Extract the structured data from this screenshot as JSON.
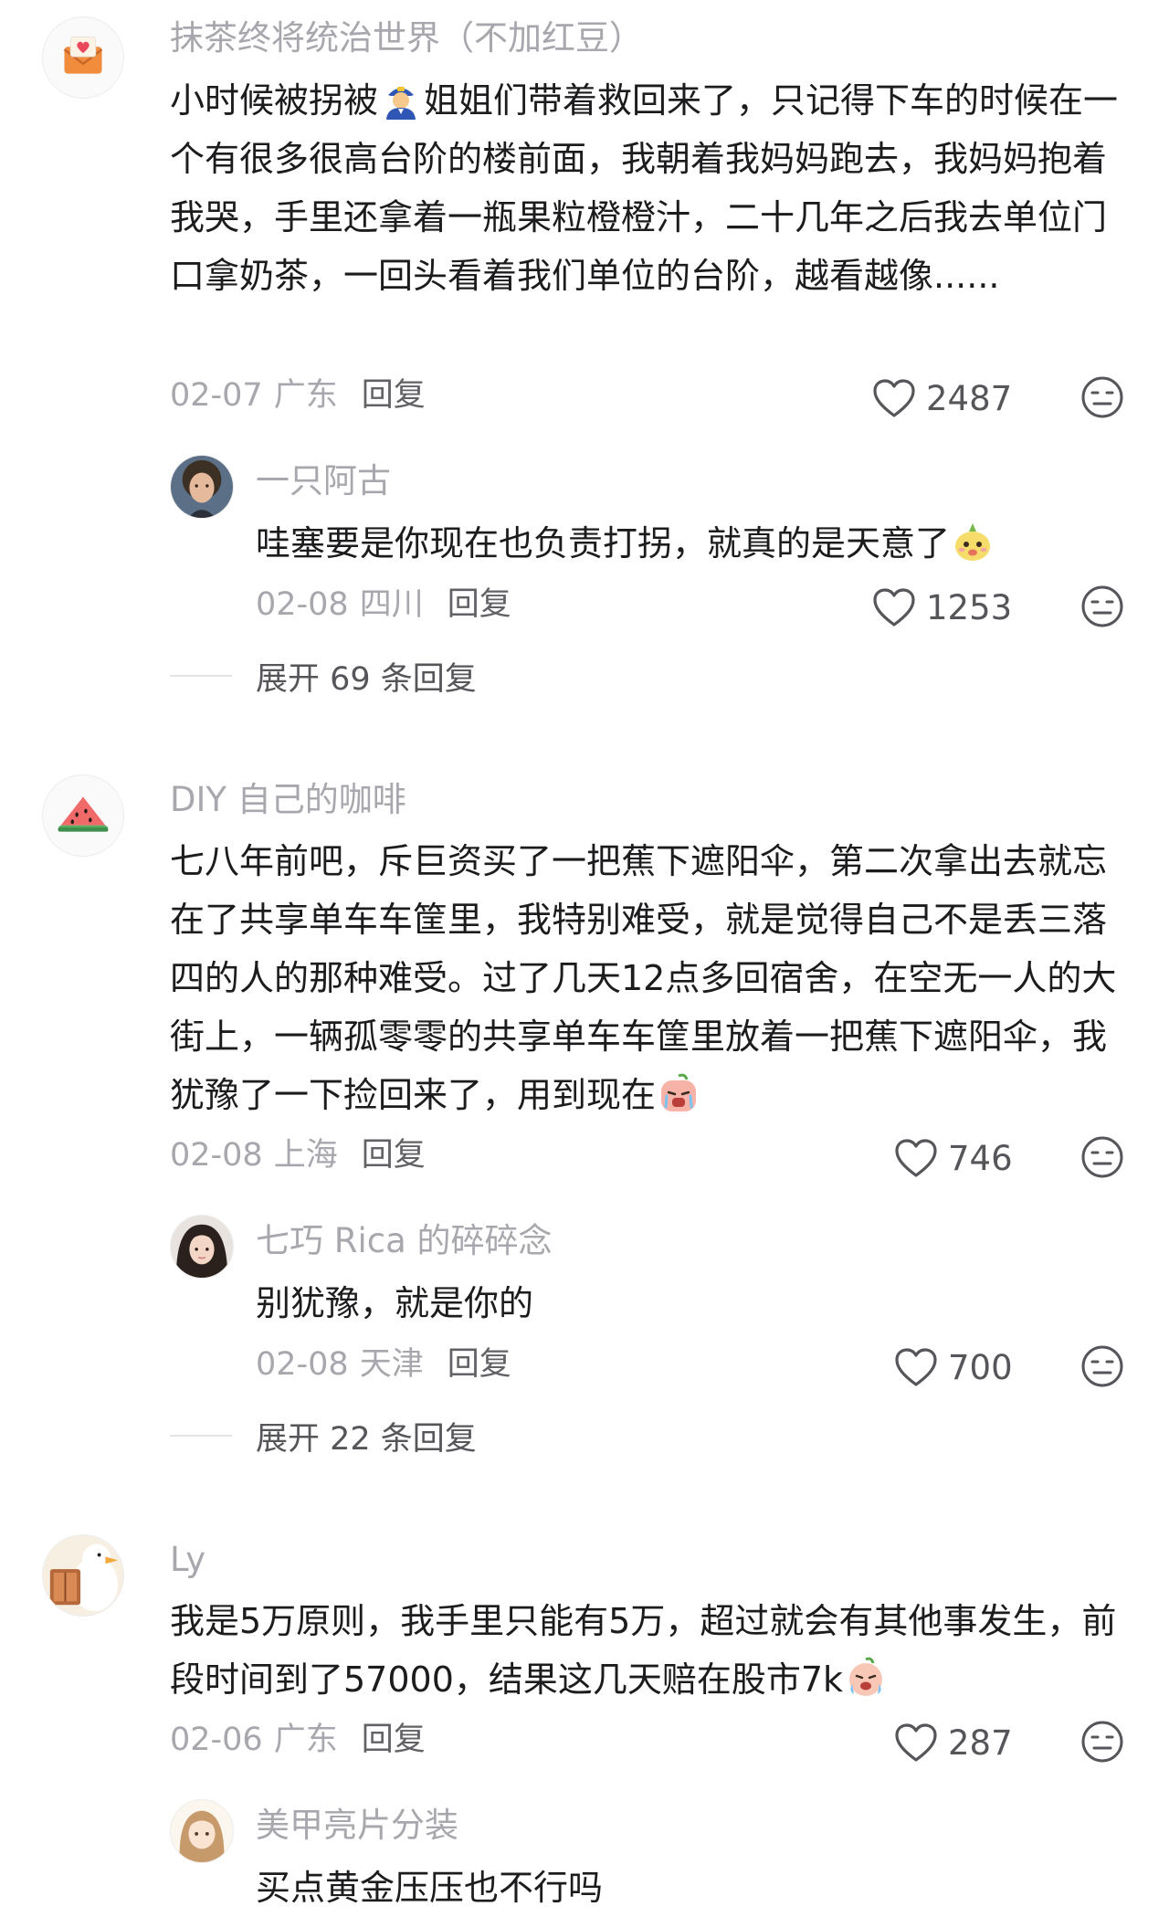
{
  "comments": [
    {
      "name": "抹茶终将统治世界（不加红豆）",
      "avatar": "envelope-heart-icon",
      "body_before": "小时候被拐被",
      "emoji": "police-officer-emoji",
      "body_after": "姐姐们带着救回来了，只记得下车的时候在一个有很多很高台阶的楼前面，我朝着我妈妈跑去，我妈妈抱着我哭，手里还拿着一瓶果粒橙橙汁，二十几年之后我去单位门口拿奶茶，一回头看着我们单位的台阶，越看越像......",
      "date": "02-07",
      "location": "广东",
      "reply": "回复",
      "likes": "2487",
      "sub": {
        "name": "一只阿古",
        "avatar": "young-man-photo-avatar",
        "body_before": "哇塞要是你现在也负责打拐，就真的是天意了",
        "emoji": "cute-onion-emoji",
        "date": "02-08",
        "location": "四川",
        "reply": "回复",
        "likes": "1253"
      },
      "expand": "展开 69 条回复"
    },
    {
      "name": "DIY 自己的咖啡",
      "avatar": "watermelon-icon",
      "body_before": "七八年前吧，斥巨资买了一把蕉下遮阳伞，第二次拿出去就忘在了共享单车车筐里，我特别难受，就是觉得自己不是丢三落四的人的那种难受。过了几天12点多回宿舍，在空无一人的大街上，一辆孤零零的共享单车车筐里放着一把蕉下遮阳伞，我犹豫了一下捡回来了，用到现在",
      "emoji": "crying-peach-emoji",
      "date": "02-08",
      "location": "上海",
      "reply": "回复",
      "likes": "746",
      "sub": {
        "name": "七巧 Rica 的碎碎念",
        "avatar": "girl-photo-avatar",
        "body_before": "别犹豫，就是你的",
        "date": "02-08",
        "location": "天津",
        "reply": "回复",
        "likes": "700"
      },
      "expand": "展开 22 条回复"
    },
    {
      "name": "Ly",
      "avatar": "duck-reading-avatar",
      "body_before": "我是5万原则，我手里只能有5万，超过就会有其他事发生，前段时间到了57000，结果这几天赔在股市7k",
      "emoji": "crying-face-emoji",
      "date": "02-06",
      "location": "广东",
      "reply": "回复",
      "likes": "287",
      "sub": {
        "name": "美甲亮片分装",
        "avatar": "anime-girl-avatar",
        "body_before": "买点黄金压压也不行吗"
      }
    }
  ],
  "colors": {
    "meta_gray": "#a7a7ad",
    "text": "#1c1c1e",
    "icon_gray": "#55555a"
  }
}
